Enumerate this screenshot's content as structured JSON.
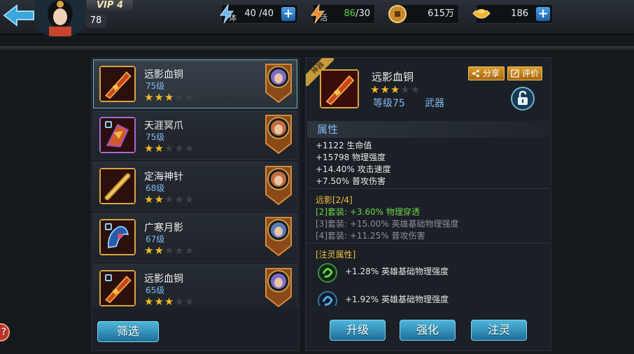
{
  "header": {
    "vip": "VIP 4",
    "player_level": "78",
    "stamina": {
      "label": "体",
      "value": "40 /40"
    },
    "energy": {
      "label": "活",
      "current": "86",
      "max": "/30"
    },
    "coins": "615万",
    "gems": "186"
  },
  "equipment_list": [
    {
      "name": "远影血铜",
      "level": "75级",
      "stars": 3,
      "max_stars": 5,
      "selected": true,
      "locked": false,
      "rarity": "gold",
      "hero_color": "#7a6cc7"
    },
    {
      "name": "天涯冥爪",
      "level": "75级",
      "stars": 2,
      "max_stars": 5,
      "selected": false,
      "locked": true,
      "rarity": "purple",
      "hero_color": "#c46b3e"
    },
    {
      "name": "定海神针",
      "level": "68级",
      "stars": 2,
      "max_stars": 5,
      "selected": false,
      "locked": false,
      "rarity": "gold",
      "hero_color": "#c46b3e"
    },
    {
      "name": "广寒月影",
      "level": "67级",
      "stars": 2,
      "max_stars": 5,
      "selected": false,
      "locked": true,
      "rarity": "gold",
      "hero_color": "#5a7ab8"
    },
    {
      "name": "远影血铜",
      "level": "65级",
      "stars": 3,
      "max_stars": 5,
      "selected": false,
      "locked": true,
      "rarity": "gold",
      "hero_color": "#7a6cc7"
    }
  ],
  "filter_label": "筛选",
  "detail": {
    "tag": "神器",
    "name": "远影血铜",
    "stars": 3,
    "max_stars": 5,
    "level": "等级75",
    "type": "武器",
    "share_label": "分享",
    "rate_label": "评价",
    "attributes_title": "属性",
    "attributes": [
      "+1122 生命值",
      "+15798 物理强度",
      "+14.40% 攻击速度",
      "+7.50% 普攻伤害"
    ],
    "set_title": "远影[2/4]",
    "set_bonuses": [
      {
        "text": "[2]套装: +3.60% 物理穿透",
        "active": true
      },
      {
        "text": "[3]套装: +15.00% 英雄基础物理强度",
        "active": false
      },
      {
        "text": "[4]套装: +11.25% 普攻伤害",
        "active": false
      }
    ],
    "spirit_title": "[注灵属性]",
    "spirit_attrs": [
      "+1.28% 英雄基础物理强度",
      "+1.92% 英雄基础物理强度"
    ]
  },
  "actions": {
    "upgrade": "升级",
    "enhance": "强化",
    "spirit": "注灵"
  },
  "side_chip": "?",
  "colors": {
    "accent_blue": "#4fb6d9",
    "gold": "#f3b925",
    "level_blue": "#7fb8f0",
    "active_green": "#6dd24b"
  }
}
